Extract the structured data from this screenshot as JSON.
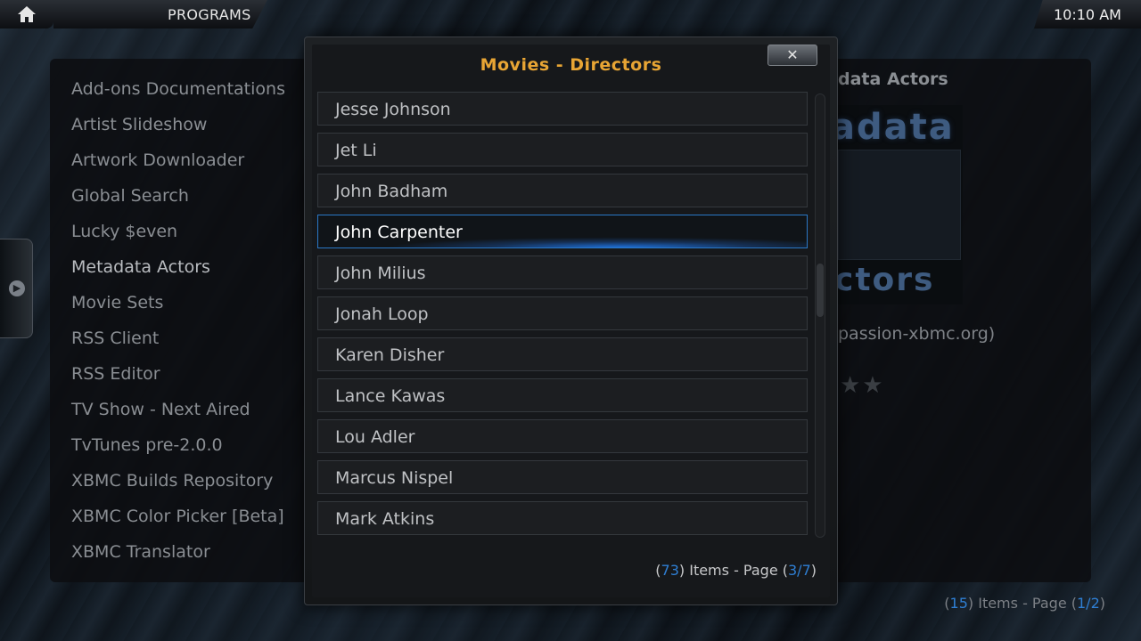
{
  "header": {
    "section": "PROGRAMS",
    "clock": "10:10 AM",
    "home_icon": "home-icon"
  },
  "background_list": {
    "items": [
      "Add-ons Documentations",
      "Artist Slideshow",
      "Artwork Downloader",
      "Global Search",
      "Lucky $even",
      "Metadata Actors",
      "Movie Sets",
      "RSS Client",
      "RSS Editor",
      "TV Show - Next Aired",
      "TvTunes pre-2.0.0",
      "XBMC Builds Repository",
      "XBMC Color Picker [Beta]",
      "XBMC Translator"
    ],
    "count": "15",
    "page_current": "1",
    "page_total": "2"
  },
  "info": {
    "title": "data Actors",
    "logo_top": "adata",
    "logo_bottom": "ctors",
    "link": "passion-xbmc.org)",
    "stars": "★★"
  },
  "dialog": {
    "title": "Movies - Directors",
    "close_label": "✕",
    "items": [
      "Jesse Johnson",
      "Jet Li",
      "John Badham",
      "John Carpenter",
      "John Milius",
      "Jonah Loop",
      "Karen Disher",
      "Lance Kawas",
      "Lou Adler",
      "Marcus Nispel",
      "Mark Atkins"
    ],
    "focused_index": 3,
    "count": "73",
    "page_current": "3",
    "page_total": "7",
    "items_label": "Items - Page"
  },
  "colors": {
    "accent_title": "#e8a534",
    "focus_blue": "#2a78c6",
    "count_blue": "#2f7fd4"
  }
}
